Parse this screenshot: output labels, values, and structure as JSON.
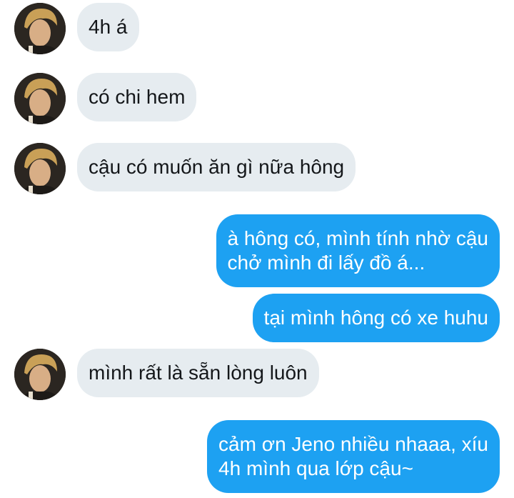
{
  "conversation": {
    "messages": [
      {
        "direction": "incoming",
        "text": "4h á"
      },
      {
        "direction": "incoming",
        "text": "có chi hem"
      },
      {
        "direction": "incoming",
        "text": "cậu có muốn ăn gì nữa hông"
      },
      {
        "direction": "outgoing",
        "lines": [
          "à hông có, mình tính nhờ cậu",
          "chở mình đi lấy đồ á..."
        ]
      },
      {
        "direction": "outgoing",
        "text": "tại mình hông có xe huhu"
      },
      {
        "direction": "incoming",
        "text": "mình rất là sẵn lòng luôn"
      },
      {
        "direction": "outgoing",
        "lines": [
          "cảm ơn Jeno nhiều nhaaa, xíu",
          "4h mình qua lớp cậu~"
        ]
      }
    ]
  },
  "colors": {
    "incoming_bubble": "#e6ecf0",
    "incoming_text": "#14171a",
    "outgoing_bubble": "#1da1f2",
    "outgoing_text": "#ffffff"
  },
  "icons": {
    "avatar": "user-avatar-photo"
  }
}
